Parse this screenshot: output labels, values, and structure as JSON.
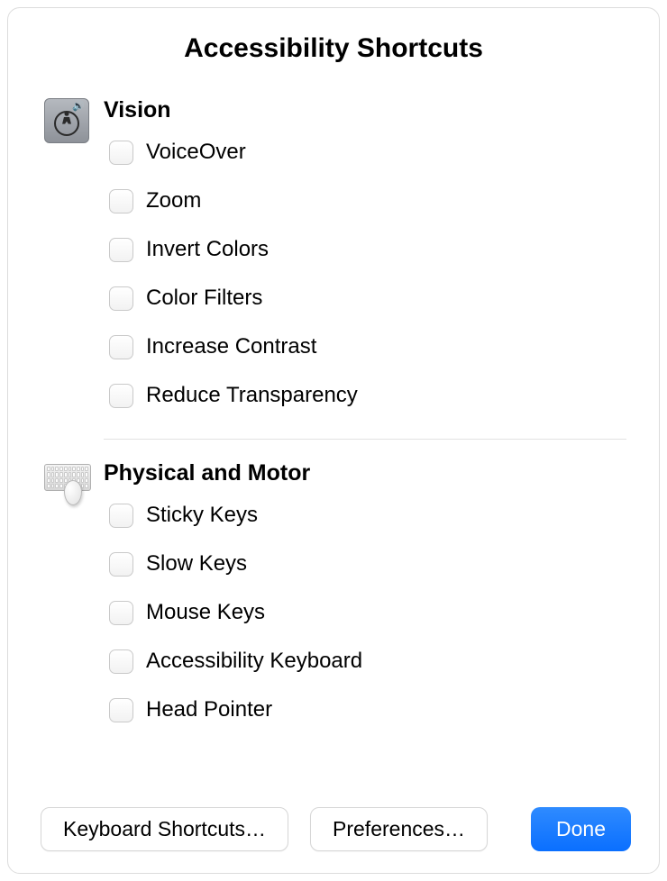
{
  "title": "Accessibility Shortcuts",
  "sections": [
    {
      "heading": "Vision",
      "icon": "accessibility-vision-icon",
      "options": [
        {
          "label": "VoiceOver",
          "checked": false
        },
        {
          "label": "Zoom",
          "checked": false
        },
        {
          "label": "Invert Colors",
          "checked": false
        },
        {
          "label": "Color Filters",
          "checked": false
        },
        {
          "label": "Increase Contrast",
          "checked": false
        },
        {
          "label": "Reduce Transparency",
          "checked": false
        }
      ]
    },
    {
      "heading": "Physical and Motor",
      "icon": "keyboard-mouse-icon",
      "options": [
        {
          "label": "Sticky Keys",
          "checked": false
        },
        {
          "label": "Slow Keys",
          "checked": false
        },
        {
          "label": "Mouse Keys",
          "checked": false
        },
        {
          "label": "Accessibility Keyboard",
          "checked": false
        },
        {
          "label": "Head Pointer",
          "checked": false
        }
      ]
    }
  ],
  "footer": {
    "keyboard_shortcuts": "Keyboard Shortcuts…",
    "preferences": "Preferences…",
    "done": "Done"
  },
  "colors": {
    "primary": "#0a6fff",
    "border": "#dcdcdc"
  }
}
